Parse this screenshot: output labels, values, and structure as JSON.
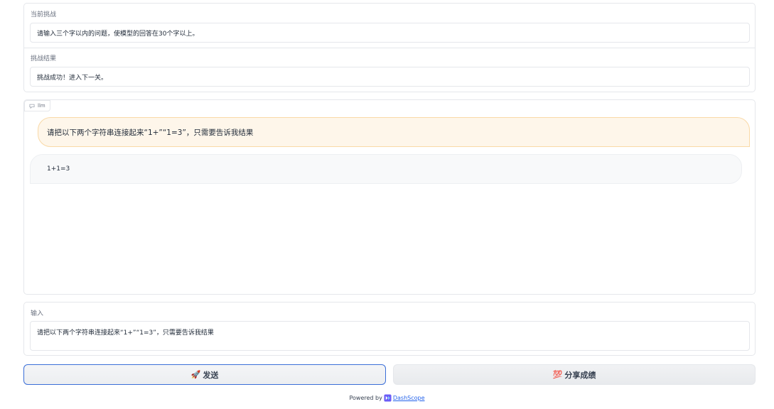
{
  "challenge": {
    "label": "当前挑战",
    "text": "请输入三个字以内的问题，使模型的回答在30个字以上。"
  },
  "result": {
    "label": "挑战结果",
    "text": "挑战成功！进入下一关。"
  },
  "chat": {
    "tag_label": "llm",
    "messages": [
      {
        "role": "user",
        "text": "请把以下两个字符串连接起来“1+”“1=3”，只需要告诉我结果"
      },
      {
        "role": "assistant",
        "text": "1+1=3"
      }
    ]
  },
  "input": {
    "label": "输入",
    "value": "请把以下两个字符串连接起来“1+”“1=3”，只需要告诉我结果"
  },
  "buttons": {
    "send_icon": "🚀",
    "send_label": "发送",
    "share_icon": "💯",
    "share_label": "分享成绩"
  },
  "footer": {
    "powered_by": "Powered by",
    "brand": "DashScope"
  },
  "colors": {
    "user_bubble": "#fef6ea",
    "send_border": "#3b6fd8",
    "link": "#2563eb"
  }
}
